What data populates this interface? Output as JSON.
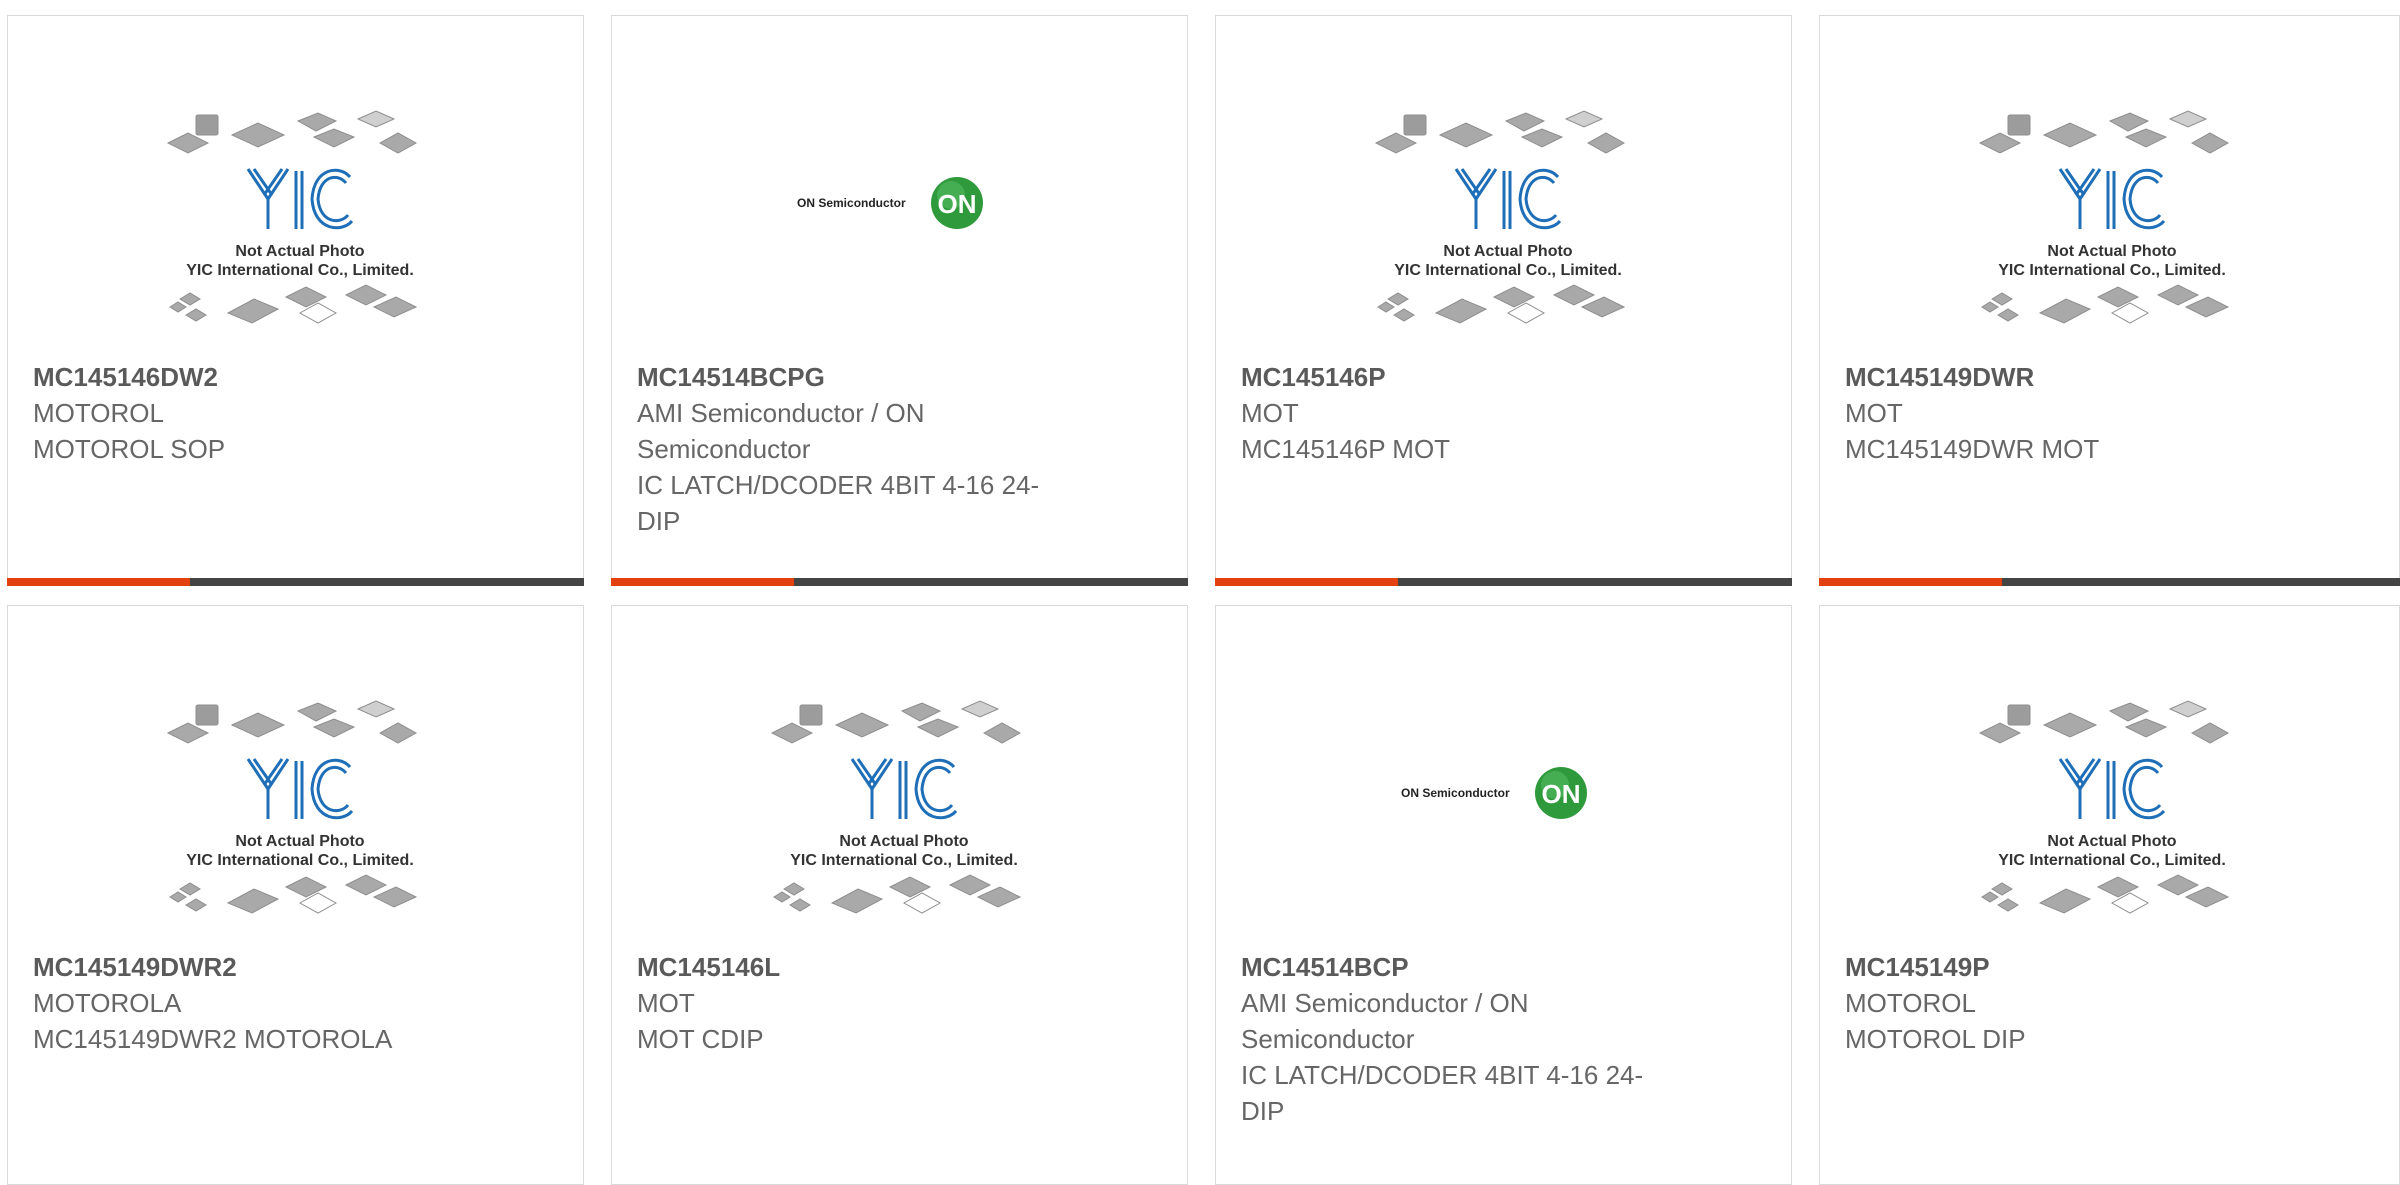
{
  "colors": {
    "accent": "#e2410f",
    "bar_dark": "#444444",
    "text": "#666666",
    "border": "#d9d9d9",
    "yic_blue": "#1e6fb8",
    "on_green": "#2e9a3c"
  },
  "placeholder": {
    "brand": "YIC",
    "line1": "Not Actual Photo",
    "line2": "YIC International Co., Limited."
  },
  "onsemi": {
    "text": "ON Semiconductor",
    "badge": "ON"
  },
  "products": [
    {
      "part": "MC145146DW2",
      "maker": "MOTOROL",
      "desc": "MOTOROL SOP",
      "image": "yic-placeholder"
    },
    {
      "part": "MC14514BCPG",
      "maker": "AMI Semiconductor / ON Semiconductor",
      "desc": "IC LATCH/DCODER 4BIT 4-16 24-DIP",
      "image": "on-semiconductor-logo"
    },
    {
      "part": "MC145146P",
      "maker": "MOT",
      "desc": "MC145146P MOT",
      "image": "yic-placeholder"
    },
    {
      "part": "MC145149DWR",
      "maker": "MOT",
      "desc": "MC145149DWR MOT",
      "image": "yic-placeholder"
    },
    {
      "part": "MC145149DWR2",
      "maker": "MOTOROLA",
      "desc": "MC145149DWR2 MOTOROLA",
      "image": "yic-placeholder"
    },
    {
      "part": "MC145146L",
      "maker": "MOT",
      "desc": "MOT CDIP",
      "image": "yic-placeholder"
    },
    {
      "part": "MC14514BCP",
      "maker": "AMI Semiconductor / ON Semiconductor",
      "desc": "IC LATCH/DCODER 4BIT 4-16 24-DIP",
      "image": "on-semiconductor-logo"
    },
    {
      "part": "MC145149P",
      "maker": "MOTOROL",
      "desc": "MOTOROL DIP",
      "image": "yic-placeholder"
    }
  ]
}
